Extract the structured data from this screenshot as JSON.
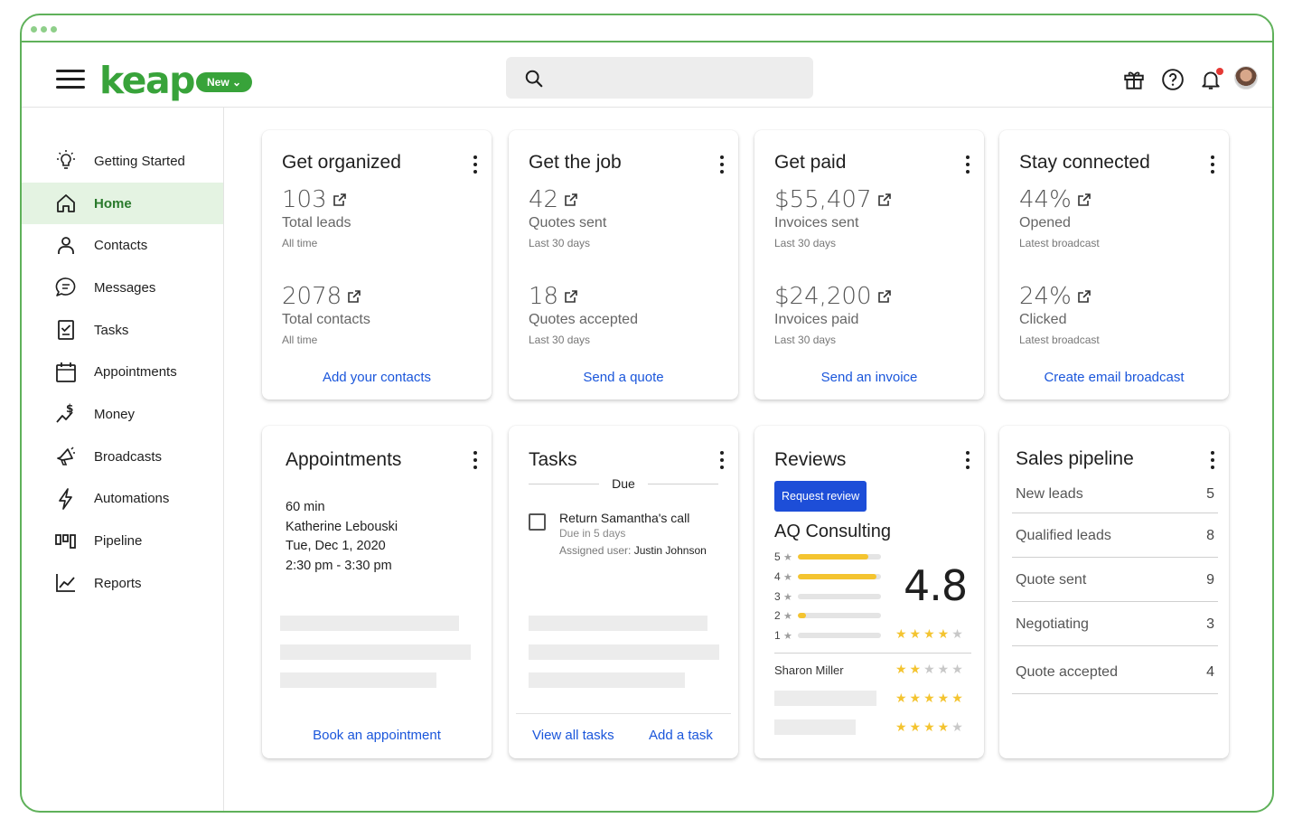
{
  "brand": {
    "logo": "keap",
    "badge": "New ⌄",
    "accent": "#38a33a",
    "link_color": "#1a56db"
  },
  "header": {
    "search_placeholder": ""
  },
  "sidebar": {
    "items": [
      {
        "label": "Getting Started",
        "icon": "lightbulb-icon"
      },
      {
        "label": "Home",
        "icon": "home-icon",
        "active": true
      },
      {
        "label": "Contacts",
        "icon": "person-icon"
      },
      {
        "label": "Messages",
        "icon": "chat-icon"
      },
      {
        "label": "Tasks",
        "icon": "checklist-icon"
      },
      {
        "label": "Appointments",
        "icon": "calendar-icon"
      },
      {
        "label": "Money",
        "icon": "money-icon"
      },
      {
        "label": "Broadcasts",
        "icon": "megaphone-icon"
      },
      {
        "label": "Automations",
        "icon": "bolt-icon"
      },
      {
        "label": "Pipeline",
        "icon": "pipeline-icon"
      },
      {
        "label": "Reports",
        "icon": "chart-icon"
      }
    ]
  },
  "cards": {
    "organized": {
      "title": "Get organized",
      "stat1": {
        "value": "103",
        "label": "Total leads",
        "sub": "All time"
      },
      "stat2": {
        "value": "2078",
        "label": "Total contacts",
        "sub": "All time"
      },
      "link": "Add your contacts"
    },
    "job": {
      "title": "Get the job",
      "stat1": {
        "value": "42",
        "label": "Quotes sent",
        "sub": "Last 30 days"
      },
      "stat2": {
        "value": "18",
        "label": "Quotes accepted",
        "sub": "Last 30 days"
      },
      "link": "Send a quote"
    },
    "paid": {
      "title": "Get paid",
      "stat1": {
        "value": "$55,407",
        "label": "Invoices sent",
        "sub": "Last 30 days"
      },
      "stat2": {
        "value": "$24,200",
        "label": "Invoices paid",
        "sub": "Last 30 days"
      },
      "link": "Send an invoice"
    },
    "connected": {
      "title": "Stay connected",
      "stat1": {
        "value": "44%",
        "label": "Opened",
        "sub": "Latest broadcast"
      },
      "stat2": {
        "value": "24%",
        "label": "Clicked",
        "sub": "Latest broadcast"
      },
      "link": "Create email broadcast"
    },
    "appointments": {
      "title": "Appointments",
      "duration": "60 min",
      "name": "Katherine Lebouski",
      "date": "Tue, Dec 1, 2020",
      "time": "2:30 pm - 3:30 pm",
      "link": "Book an appointment"
    },
    "tasks": {
      "title": "Tasks",
      "due_label": "Due",
      "task": "Return Samantha's call",
      "task_due": "Due in 5 days",
      "assigned_prefix": "Assigned user:",
      "assigned_user": "Justin Johnson",
      "link_view": "View all tasks",
      "link_add": "Add a task"
    },
    "reviews": {
      "title": "Reviews",
      "button": "Request review",
      "business": "AQ Consulting",
      "rating": "4.8",
      "distribution": [
        {
          "star": "5",
          "fraction": 0.85
        },
        {
          "star": "4",
          "fraction": 0.95
        },
        {
          "star": "3",
          "fraction": 0.0
        },
        {
          "star": "2",
          "fraction": 0.1
        },
        {
          "star": "1",
          "fraction": 0.0
        }
      ],
      "reviewer": "Sharon Miller"
    },
    "pipeline": {
      "title": "Sales pipeline",
      "rows": [
        {
          "name": "New leads",
          "count": "5"
        },
        {
          "name": "Qualified leads",
          "count": "8"
        },
        {
          "name": "Quote sent",
          "count": "9"
        },
        {
          "name": "Negotiating",
          "count": "3"
        },
        {
          "name": "Quote accepted",
          "count": "4"
        }
      ]
    }
  }
}
